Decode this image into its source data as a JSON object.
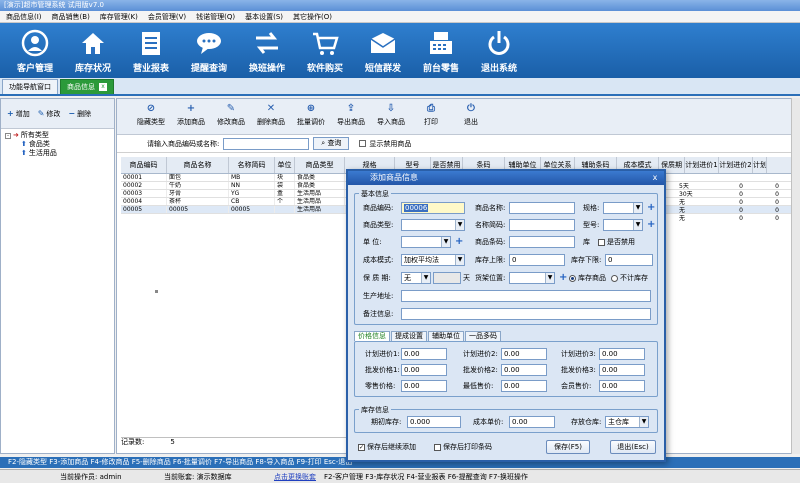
{
  "window": {
    "title": "[演示]超市管理系统 试用版v7.0"
  },
  "menu": [
    "商品信息(I)",
    "商品销售(B)",
    "库存管理(K)",
    "会员管理(V)",
    "钱诺管理(Q)",
    "基本设置(S)",
    "其它操作(O)"
  ],
  "toolbar": [
    {
      "label": "客户管理",
      "icon": "person-icon"
    },
    {
      "label": "库存状况",
      "icon": "house-icon"
    },
    {
      "label": "营业报表",
      "icon": "report-icon"
    },
    {
      "label": "提醒查询",
      "icon": "chat-icon"
    },
    {
      "label": "换班操作",
      "icon": "swap-icon"
    },
    {
      "label": "软件购买",
      "icon": "cart-icon"
    },
    {
      "label": "短信群发",
      "icon": "envelope-icon"
    },
    {
      "label": "前台零售",
      "icon": "register-icon"
    },
    {
      "label": "退出系统",
      "icon": "power-icon"
    }
  ],
  "tabs": {
    "nav": "功能导航窗口",
    "active": "商品信息",
    "close": "x"
  },
  "left": {
    "buttons": [
      {
        "icon": "+",
        "label": "增加"
      },
      {
        "icon": "✎",
        "label": "修改"
      },
      {
        "icon": "−",
        "label": "删除"
      }
    ],
    "tree": {
      "root": "所有类型",
      "toggle": "-",
      "children": [
        "食品类",
        "生活用品"
      ]
    }
  },
  "main": {
    "buttons": [
      {
        "icon": "⊘",
        "label": "隐藏类型"
      },
      {
        "icon": "+",
        "label": "添加商品"
      },
      {
        "icon": "✎",
        "label": "修改商品"
      },
      {
        "icon": "✕",
        "label": "删除商品"
      },
      {
        "icon": "⊕",
        "label": "批量调价"
      },
      {
        "icon": "⇪",
        "label": "导出商品"
      },
      {
        "icon": "⇩",
        "label": "导入商品"
      },
      {
        "icon": "⎙",
        "label": "打印"
      },
      {
        "icon": "⏻",
        "label": "退出"
      }
    ],
    "search": {
      "label": "请输入商品编码或名称:",
      "button": "查询",
      "checkbox": "显示禁用商品"
    },
    "grid": {
      "headers": [
        "商品编码",
        "商品名称",
        "名称简码",
        "单位",
        "商品类型",
        "规格",
        "型号",
        "是否禁用",
        "条码",
        "辅助单位",
        "单位关系",
        "辅助条码",
        "成本模式",
        "保质期",
        "计划进价1",
        "计划进价2",
        "计划"
      ],
      "rows": [
        [
          "00001",
          "面包",
          "MB",
          "块",
          "食品类"
        ],
        [
          "00002",
          "牛奶",
          "NN",
          "袋",
          "食品类"
        ],
        [
          "00003",
          "牙膏",
          "YG",
          "盒",
          "生活用品"
        ],
        [
          "00004",
          "茶杯",
          "CB",
          "个",
          "生活用品"
        ],
        [
          "00005",
          "00005",
          "00005",
          "",
          "生活用品"
        ]
      ],
      "right_rows": [
        [
          "5天",
          "0",
          "0"
        ],
        [
          "30天",
          "0",
          "0"
        ],
        [
          "无",
          "0",
          "0"
        ],
        [
          "无",
          "0",
          "0"
        ],
        [
          "无",
          "0",
          "0"
        ]
      ]
    },
    "record": {
      "label": "记录数:",
      "value": "5"
    }
  },
  "hint": "F2-隐藏类型  F3-添加商品  F4-修改商品  F5-删除商品  F6-批量调价  F7-导出商品  F8-导入商品  F9-打印  Esc-退出",
  "status": {
    "operator": "当前操作员: admin",
    "account": "当前账套: 演示数据库",
    "link": "点击更换账套",
    "shortcuts": "F2-客户管理  F3-库存状况  F4-营业报表  F6-提醒查询  F7-换班操作"
  },
  "dialog": {
    "title": "添加商品信息",
    "close": "x",
    "basic_group": "基本信息",
    "code_label": "商品编码:",
    "code_value": "00006",
    "name_label": "商品名称:",
    "spec_label": "规格:",
    "type_label": "商品类型:",
    "short_label": "名称简码:",
    "model_label": "型号:",
    "unit_label": "单   位:",
    "barcode_label": "商品条码:",
    "kucun_label": "库",
    "disabled_label": "是否禁用",
    "cost_label": "成本模式:",
    "cost_value": "加权平均法",
    "upper_label": "库存上限:",
    "upper_value": "0",
    "lower_label": "库存下限:",
    "lower_value": "0",
    "shelf_label": "保 质 期:",
    "shelf_value": "无",
    "shelf_unit": "天",
    "shelfpos_label": "货架位置:",
    "stock_yes": "库存商品",
    "stock_no": "不计库存",
    "origin_label": "生产地址:",
    "remark_label": "备注信息:",
    "price_tabs": [
      "价格信息",
      "提成设置",
      "辅助单位",
      "一品多码"
    ],
    "prices": [
      [
        "计划进价1:",
        "0.00"
      ],
      [
        "计划进价2:",
        "0.00"
      ],
      [
        "计划进价3:",
        "0.00"
      ],
      [
        "批发价格1:",
        "0.00"
      ],
      [
        "批发价格2:",
        "0.00"
      ],
      [
        "批发价格3:",
        "0.00"
      ],
      [
        "零售价格:",
        "0.00"
      ],
      [
        "最低售价:",
        "0.00"
      ],
      [
        "会员售价:",
        "0.00"
      ]
    ],
    "stock_group": "库存信息",
    "init_label": "期初库存:",
    "init_value": "0.000",
    "unitcost_label": "成本单价:",
    "unitcost_value": "0.00",
    "warehouse_label": "存放仓库:",
    "warehouse_value": "主仓库",
    "cont_label": "保存后继续添加",
    "print_label": "保存后打印条码",
    "save_label": "保存(F5)",
    "exit_label": "退出(Esc)"
  }
}
